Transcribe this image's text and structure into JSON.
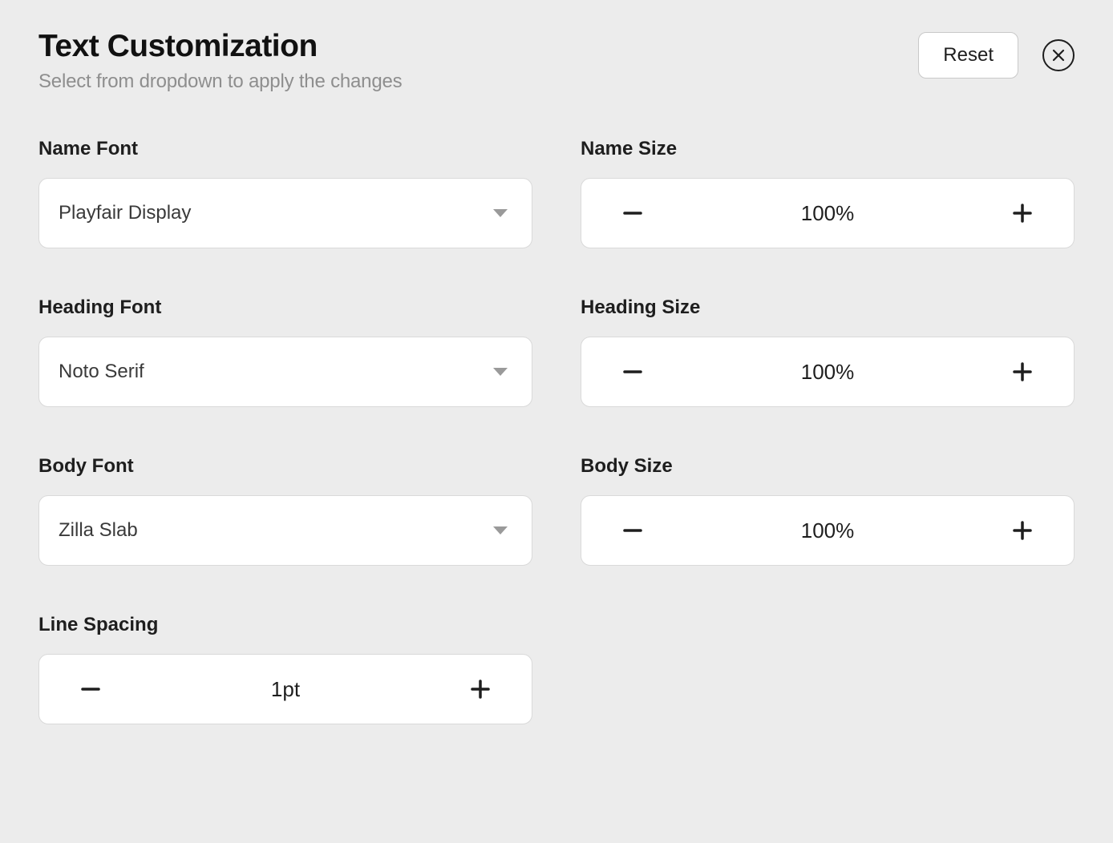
{
  "header": {
    "title": "Text Customization",
    "subtitle": "Select from dropdown to apply the changes",
    "reset_label": "Reset"
  },
  "fields": {
    "name_font": {
      "label": "Name Font",
      "value": "Playfair Display"
    },
    "name_size": {
      "label": "Name Size",
      "value": "100%"
    },
    "heading_font": {
      "label": "Heading Font",
      "value": "Noto Serif"
    },
    "heading_size": {
      "label": "Heading Size",
      "value": "100%"
    },
    "body_font": {
      "label": "Body Font",
      "value": "Zilla Slab"
    },
    "body_size": {
      "label": "Body Size",
      "value": "100%"
    },
    "line_spacing": {
      "label": "Line Spacing",
      "value": "1pt"
    }
  }
}
